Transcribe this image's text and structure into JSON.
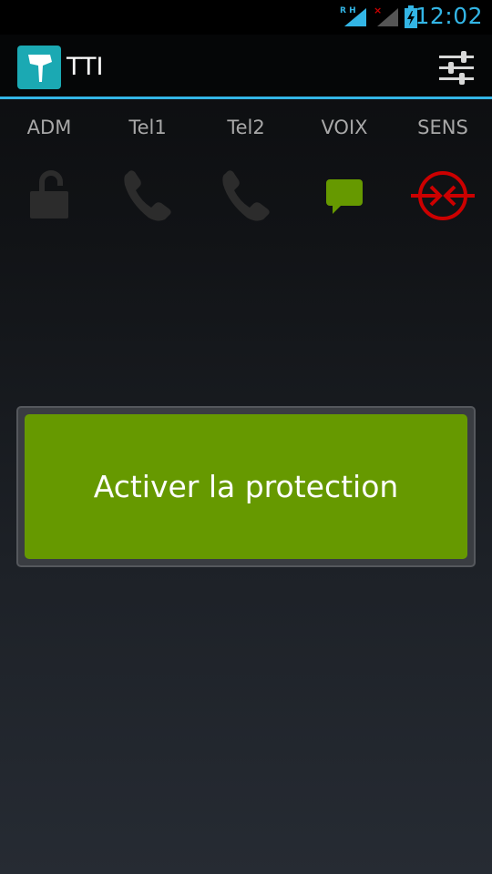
{
  "status_bar": {
    "time": "12:02",
    "signal1_tag": "R H",
    "accent_color": "#33b5e5"
  },
  "action_bar": {
    "title": "TTI",
    "logo_icon": "tti-logo-icon",
    "settings_icon": "sliders-icon"
  },
  "indicators": [
    {
      "label": "ADM",
      "icon": "unlocked-padlock-icon",
      "state": "inactive",
      "color": "#2c2c2c"
    },
    {
      "label": "Tel1",
      "icon": "phone-icon",
      "state": "inactive",
      "color": "#2c2c2c"
    },
    {
      "label": "Tel2",
      "icon": "phone-icon",
      "state": "inactive",
      "color": "#2c2c2c"
    },
    {
      "label": "VOIX",
      "icon": "chat-bubble-icon",
      "state": "active",
      "color": "#669900"
    },
    {
      "label": "SENS",
      "icon": "sensor-arrows-icon",
      "state": "alert",
      "color": "#cc0000"
    }
  ],
  "main": {
    "protect_button_label": "Activer la protection",
    "button_color": "#669900"
  }
}
